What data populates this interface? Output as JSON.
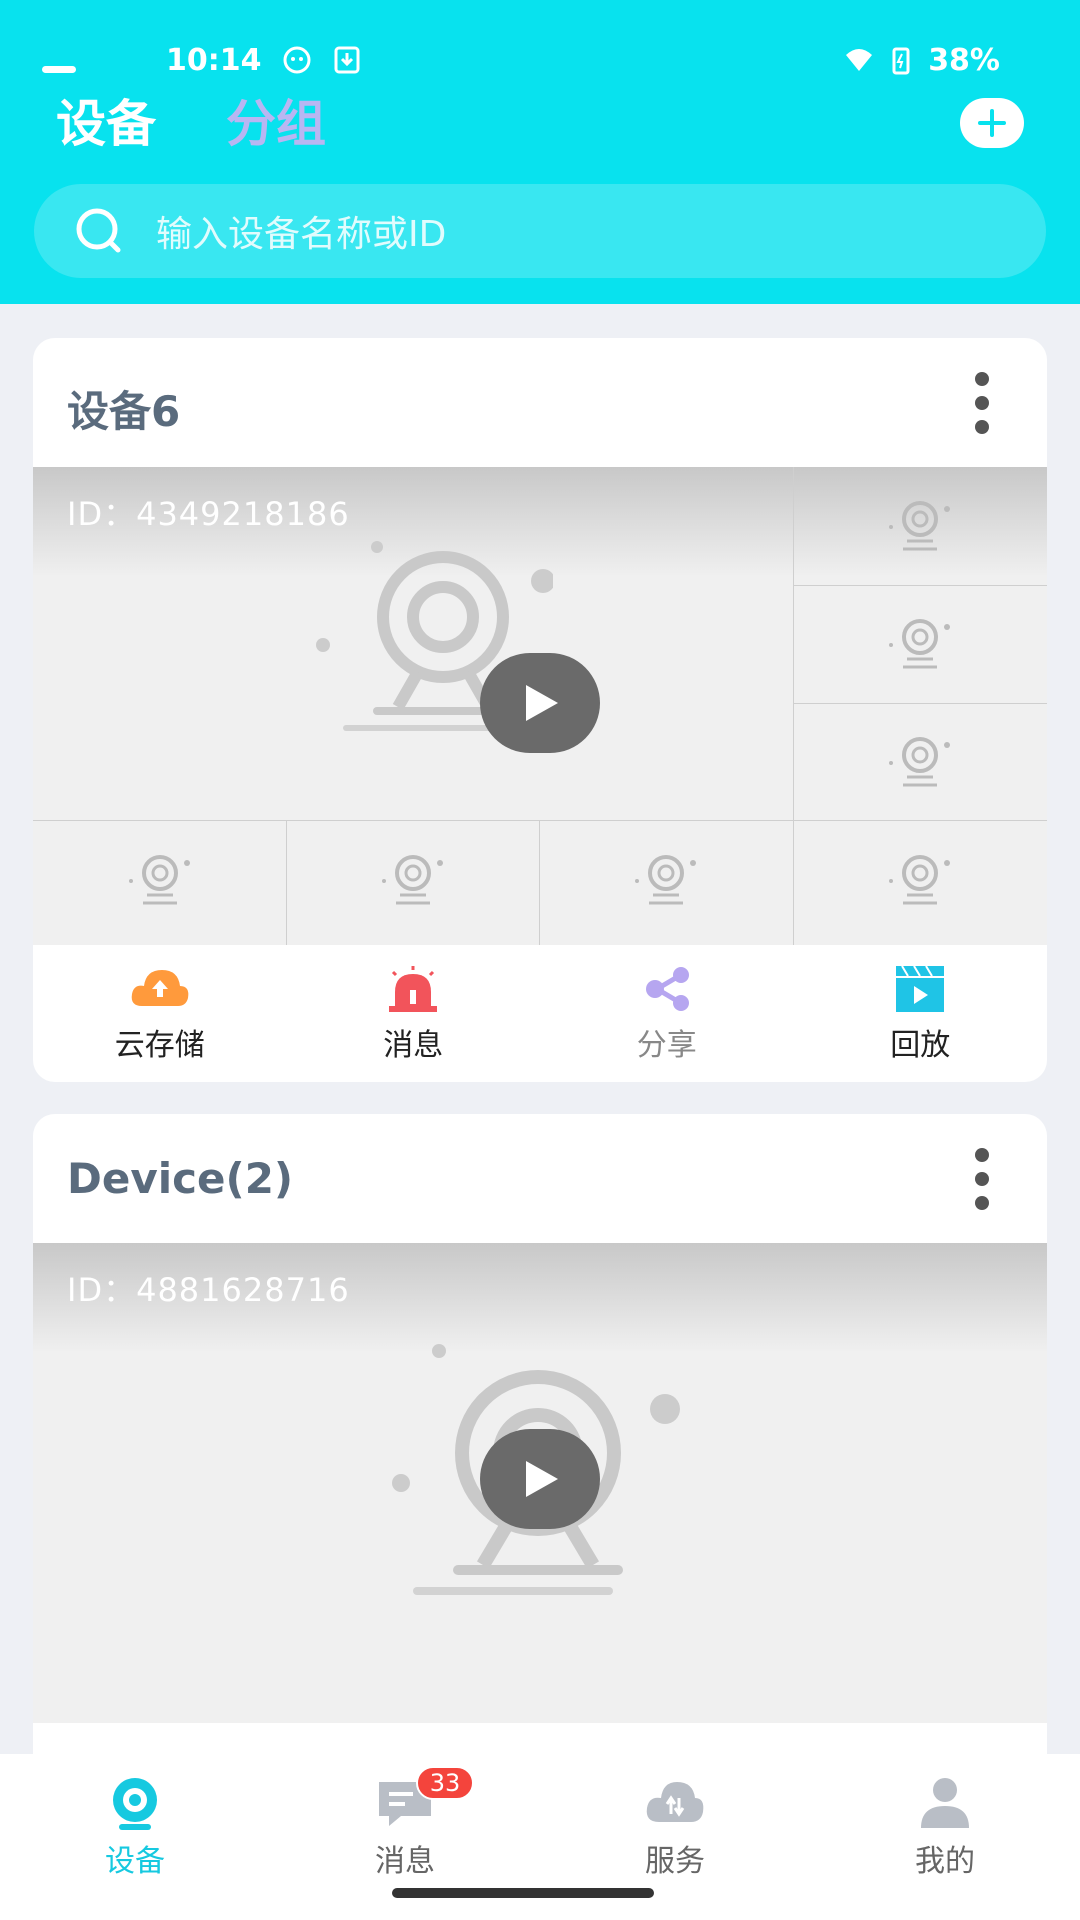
{
  "status_bar": {
    "time": "10:14",
    "battery": "38%"
  },
  "header": {
    "tabs": [
      {
        "label": "设备",
        "active": true
      },
      {
        "label": "分组",
        "active": false
      }
    ],
    "search_placeholder": "输入设备名称或ID"
  },
  "devices": [
    {
      "name": "设备6",
      "id_label": "ID：4349218186",
      "actions": [
        {
          "label": "云存储",
          "icon": "cloud-storage-icon",
          "color": "#ff9a3c"
        },
        {
          "label": "消息",
          "icon": "alarm-icon",
          "color": "#f2545b"
        },
        {
          "label": "分享",
          "icon": "share-icon",
          "color": "#b6a6f0"
        },
        {
          "label": "回放",
          "icon": "playback-icon",
          "color": "#1fc4e6"
        }
      ]
    },
    {
      "name": "Device(2)",
      "id_label": "ID：4881628716"
    }
  ],
  "bottom_nav": [
    {
      "label": "设备",
      "icon": "camera-icon",
      "active": true
    },
    {
      "label": "消息",
      "icon": "message-icon",
      "active": false,
      "badge": "33"
    },
    {
      "label": "服务",
      "icon": "cloud-service-icon",
      "active": false
    },
    {
      "label": "我的",
      "icon": "user-icon",
      "active": false
    }
  ],
  "colors": {
    "accent": "#08e2ee",
    "active_nav": "#16c9e0",
    "badge": "#f4443c"
  }
}
